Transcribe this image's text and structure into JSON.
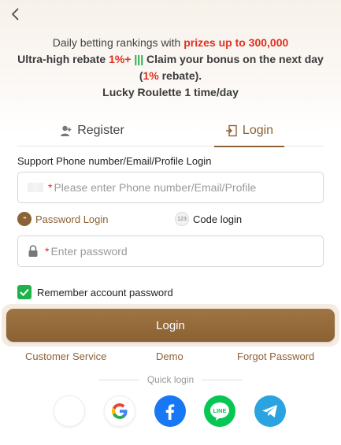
{
  "promo": {
    "line1_a": "Daily betting rankings with ",
    "line1_b": "prizes up to 300,000",
    "line2_a": "Ultra-high rebate ",
    "line2_b": "1%+",
    "line2_c": "|||",
    "line2_d": " Claim your bonus on the next day",
    "line3_a": "(",
    "line3_b": "1%",
    "line3_c": " rebate).",
    "line4": "Lucky Roulette 1 time/day"
  },
  "tabs": {
    "register": "Register",
    "login": "Login",
    "active": "login"
  },
  "form": {
    "support_label": "Support Phone number/Email/Profile Login",
    "phone_placeholder": "Please enter Phone number/Email/Profile",
    "required_mark": "*",
    "password_placeholder": "Enter password",
    "mode_password": "Password Login",
    "mode_code": "Code login",
    "mode_password_icon_text": "**",
    "mode_code_icon_text": "123",
    "remember_label": "Remember account password",
    "remember_checked": true,
    "login_button": "Login"
  },
  "links": {
    "customer_service": "Customer Service",
    "demo": "Demo",
    "forgot": "Forgot Password"
  },
  "quick_login": {
    "label": "Quick login",
    "providers": [
      "blank",
      "google-icon",
      "facebook-icon",
      "line-icon",
      "telegram-icon"
    ],
    "line_text": "LINE"
  },
  "colors": {
    "accent": "#8c6235",
    "red": "#e0301e",
    "green": "#1aa84a",
    "check": "#1fb24a"
  }
}
